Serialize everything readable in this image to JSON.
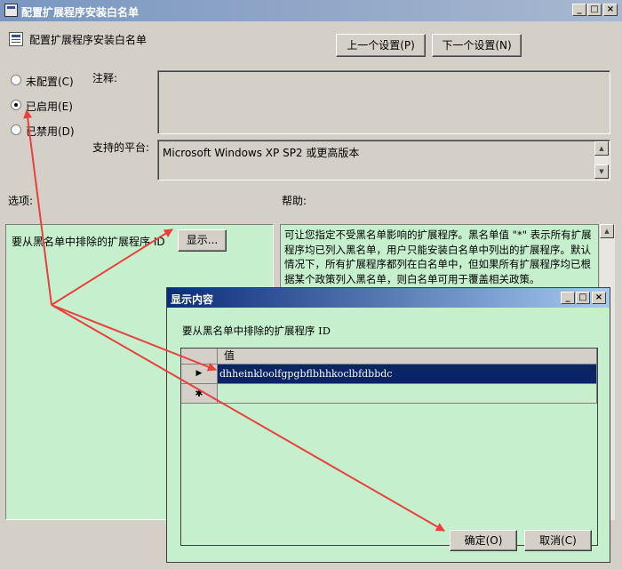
{
  "window": {
    "title": "配置扩展程序安装白名单",
    "min": "_",
    "max": "□",
    "close": "×"
  },
  "header": {
    "policy_name": "配置扩展程序安装白名单",
    "prev_label": "上一个设置(P)",
    "next_label": "下一个设置(N)"
  },
  "state": {
    "options": [
      {
        "label": "未配置(C)",
        "checked": false
      },
      {
        "label": "已启用(E)",
        "checked": true
      },
      {
        "label": "已禁用(D)",
        "checked": false
      }
    ]
  },
  "comment": {
    "label": "注释:",
    "value": ""
  },
  "platform": {
    "label": "支持的平台:",
    "value": "Microsoft Windows XP SP2 或更高版本"
  },
  "options_section": {
    "label": "选项:",
    "field_label": "要从黑名单中排除的扩展程序 ID",
    "show_button": "显示..."
  },
  "help_section": {
    "label": "帮助:",
    "text": "可让您指定不受黑名单影响的扩展程序。黑名单值 \"*\" 表示所有扩展程序均已列入黑名单，用户只能安装白名单中列出的扩展程序。默认情况下，所有扩展程序都列在白名单中，但如果所有扩展程序均已根据某个政策列入黑名单，则白名单可用于覆盖相关政策。"
  },
  "dialog": {
    "title": "显示内容",
    "min": "_",
    "max": "□",
    "close": "×",
    "field_label": "要从黑名单中排除的扩展程序 ID",
    "column_header": "值",
    "rows": [
      {
        "marker": "▶",
        "value": "dhheinkloolfgpgbflbhhkoclbfdbbdc"
      }
    ],
    "new_row_marker": "✱",
    "ok_label": "确定(O)",
    "cancel_label": "取消(C)"
  },
  "colors": {
    "selected_row": "#0a246a",
    "panel_bg": "#c6efce",
    "annotation_arrow": "#e8403c",
    "window_bg": "#d4d0c8"
  }
}
